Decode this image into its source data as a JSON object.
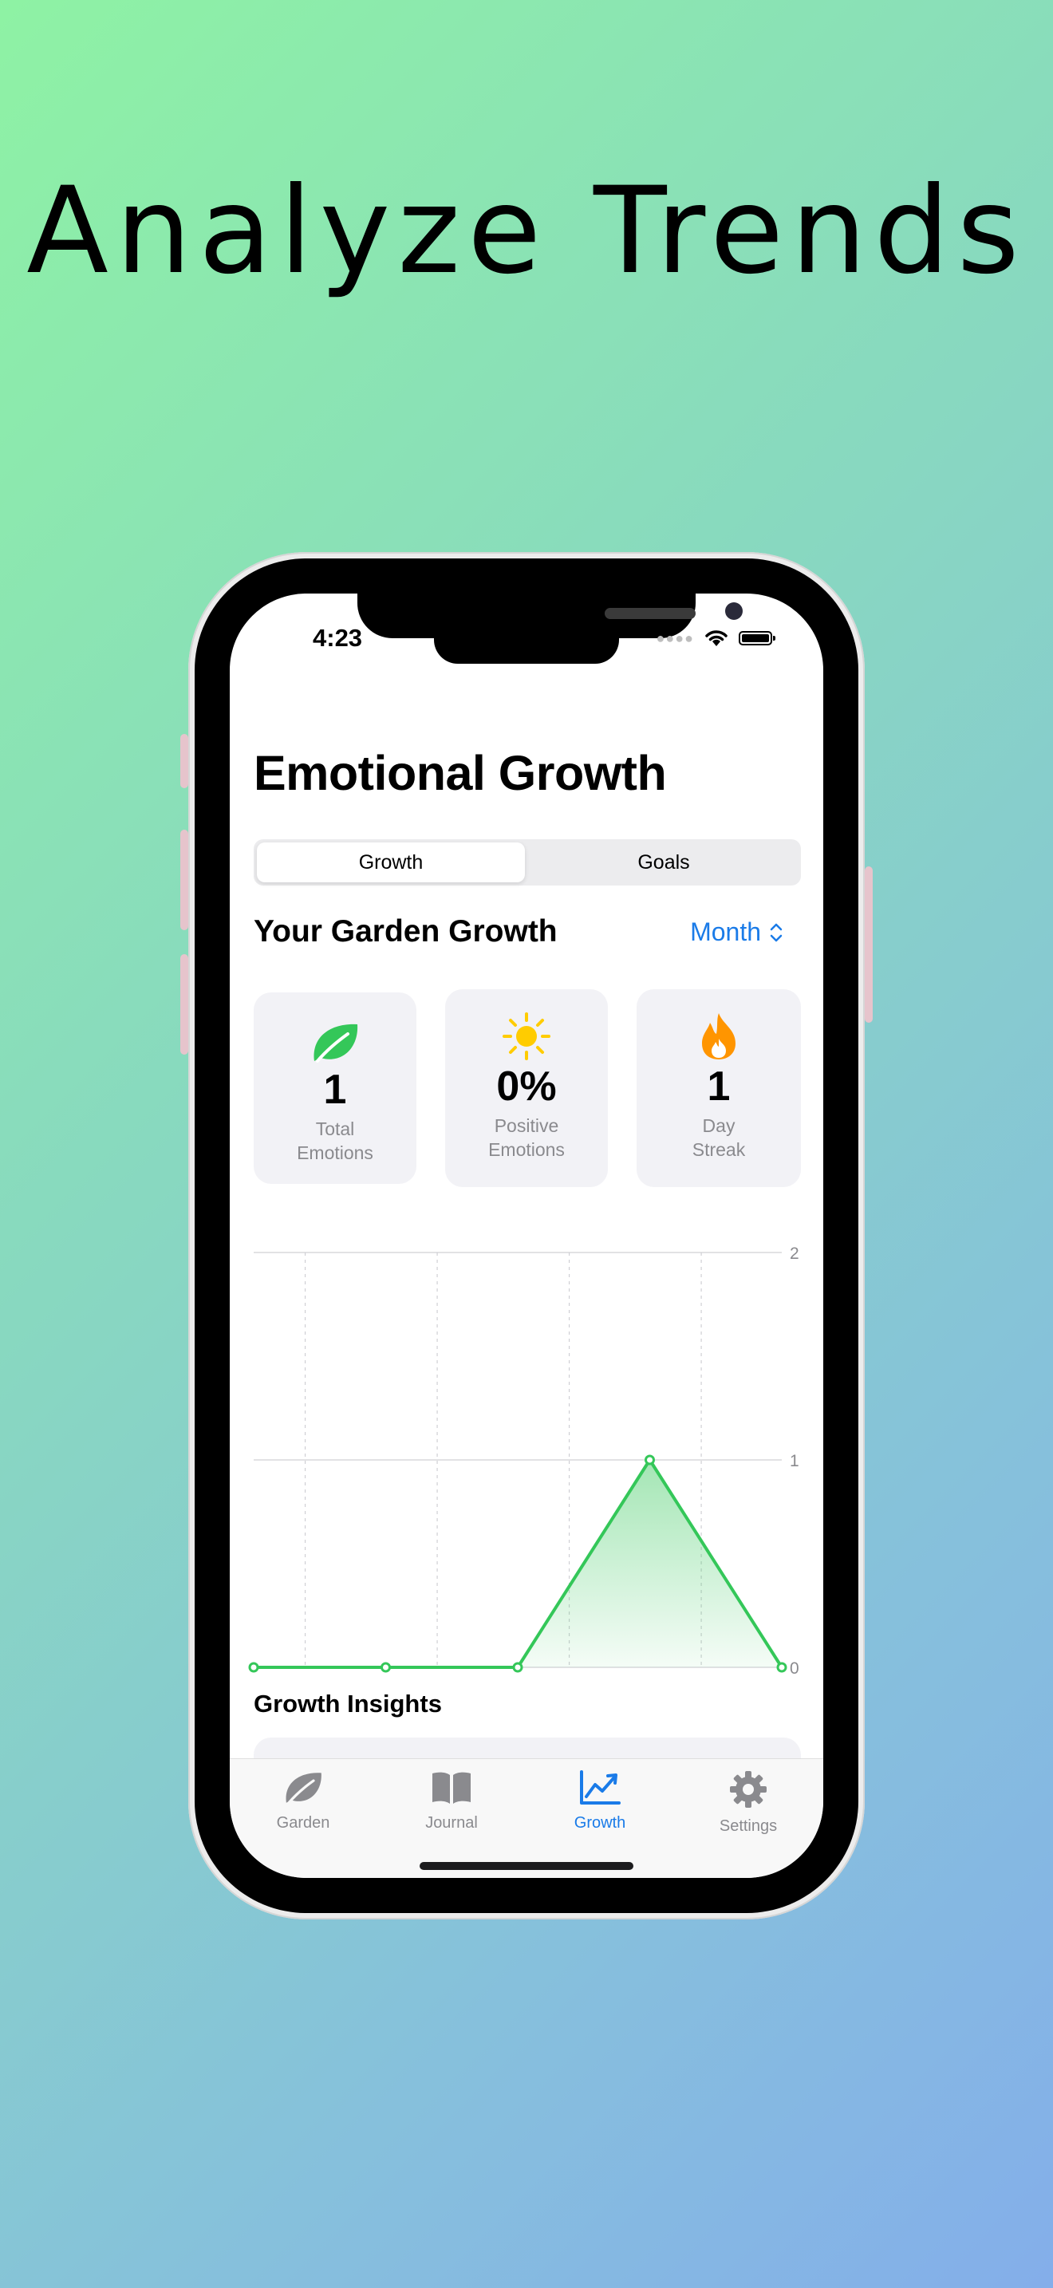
{
  "headline": "Analyze Trends",
  "status_bar": {
    "time": "4:23"
  },
  "page_title": "Emotional Growth",
  "segments": [
    "Growth",
    "Goals"
  ],
  "section_title": "Your Garden Growth",
  "period_label": "Month",
  "stats": [
    {
      "value": "1",
      "label_line1": "Total",
      "label_line2": "Emotions",
      "icon": "leaf-icon",
      "color": "#34c759"
    },
    {
      "value": "0%",
      "label_line1": "Positive",
      "label_line2": "Emotions",
      "icon": "sun-icon",
      "color": "#ffcc00"
    },
    {
      "value": "1",
      "label_line1": "Day",
      "label_line2": "Streak",
      "icon": "flame-icon",
      "color": "#ff9500"
    }
  ],
  "chart_data": {
    "type": "area",
    "x": [
      -2,
      5,
      12,
      19,
      26
    ],
    "values": [
      0,
      0,
      0,
      1,
      0
    ],
    "x_ticks": [
      "2",
      "9",
      "16",
      "23"
    ],
    "x_tick_values": [
      2,
      9,
      16,
      23
    ],
    "y_ticks": [
      "0",
      "1",
      "2"
    ],
    "xlim": [
      -2,
      26
    ],
    "ylim": [
      0,
      2
    ],
    "grid": true,
    "color": "#34c759"
  },
  "insights_title": "Growth Insights",
  "tabs": [
    {
      "label": "Garden",
      "icon": "leaf-icon"
    },
    {
      "label": "Journal",
      "icon": "book-icon"
    },
    {
      "label": "Growth",
      "icon": "chart-icon"
    },
    {
      "label": "Settings",
      "icon": "gear-icon"
    }
  ],
  "colors": {
    "accent": "#1a7be8",
    "positive": "#34c759"
  }
}
